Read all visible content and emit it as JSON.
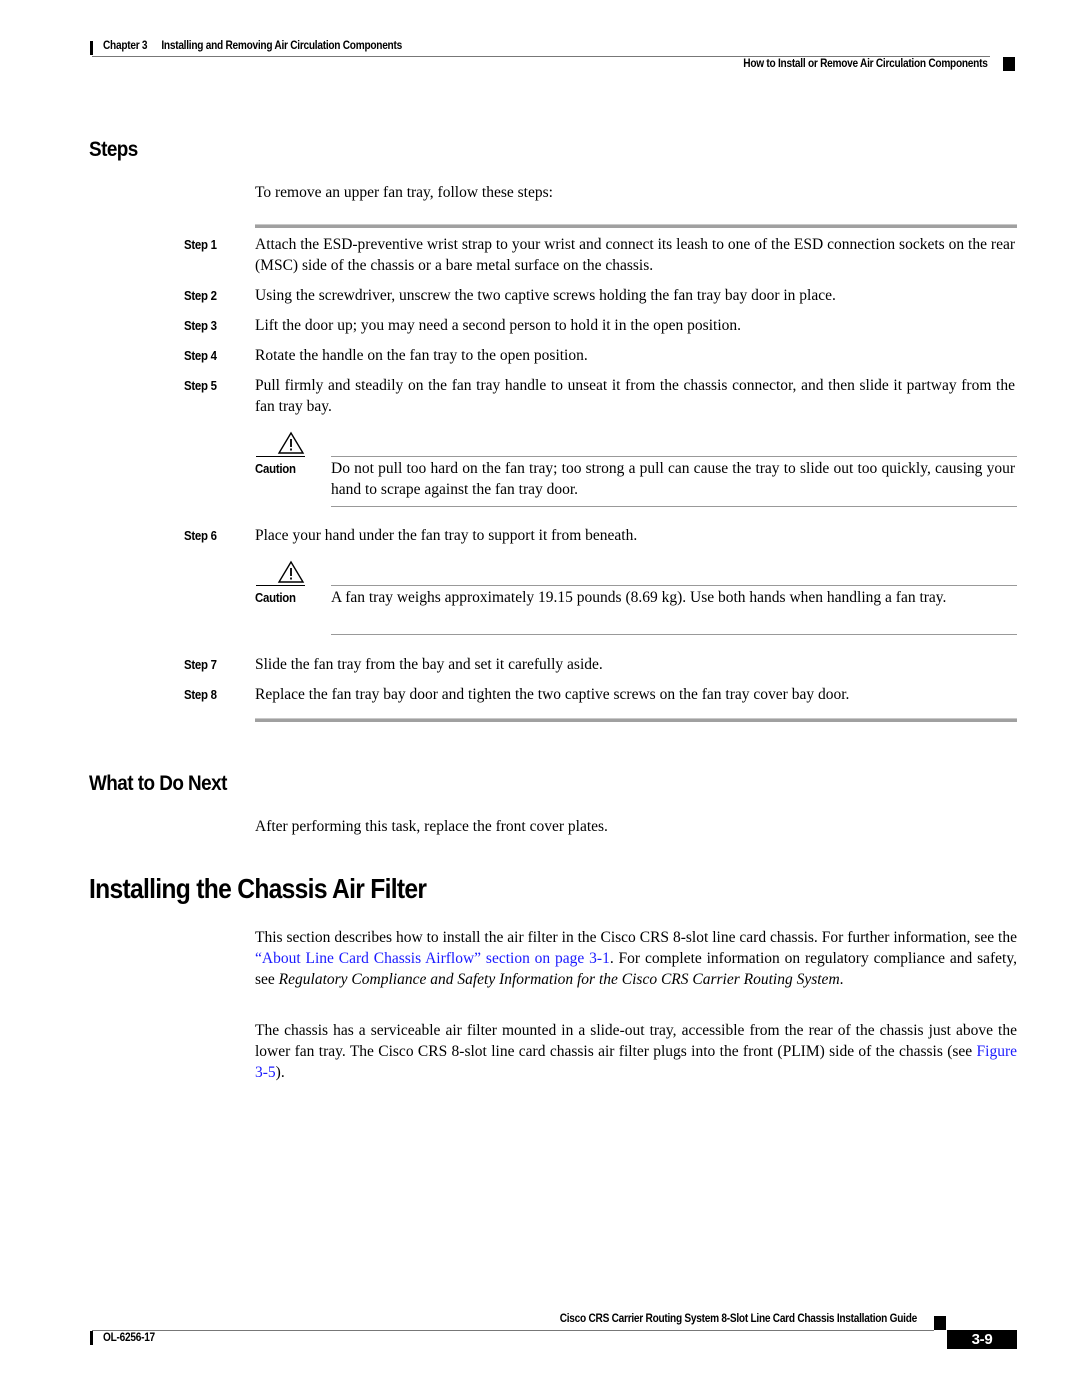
{
  "header": {
    "chapter": "Chapter 3",
    "chapter_title": "Installing and Removing Air Circulation Components",
    "section": "How to Install or Remove Air Circulation Components"
  },
  "steps_section": {
    "heading": "Steps",
    "intro": "To remove an upper fan tray, follow these steps:",
    "steps": [
      {
        "label": "Step 1",
        "text": "Attach the ESD-preventive wrist strap to your wrist and connect its leash to one of the ESD connection sockets on the rear (MSC) side of the chassis or a bare metal surface on the chassis."
      },
      {
        "label": "Step 2",
        "text": "Using the screwdriver, unscrew the two captive screws holding the fan tray bay door in place."
      },
      {
        "label": "Step 3",
        "text": "Lift the door up; you may need a second person to hold it in the open position."
      },
      {
        "label": "Step 4",
        "text": "Rotate the handle on the fan tray to the open position."
      },
      {
        "label": "Step 5",
        "text": "Pull firmly and steadily on the fan tray handle to unseat it from the chassis connector, and then slide it partway from the fan tray bay."
      },
      {
        "label": "Step 6",
        "text": "Place your hand under the fan tray to support it from beneath."
      },
      {
        "label": "Step 7",
        "text": "Slide the fan tray from the bay and set it carefully aside."
      },
      {
        "label": "Step 8",
        "text": "Replace the fan tray bay door and tighten the two captive screws on the fan tray cover bay door."
      }
    ],
    "cautions": [
      {
        "label": "Caution",
        "icon": "warning-triangle-icon",
        "text": "Do not pull too hard on the fan tray; too strong a pull can cause the tray to slide out too quickly, causing your hand to scrape against the fan tray door."
      },
      {
        "label": "Caution",
        "icon": "warning-triangle-icon",
        "text": "A fan tray weighs approximately 19.15 pounds (8.69 kg). Use both hands when handling a fan tray."
      }
    ]
  },
  "next_section": {
    "heading": "What to Do Next",
    "text": "After performing this task, replace the front cover plates."
  },
  "air_filter_section": {
    "heading": "Installing the Chassis Air Filter",
    "para1": {
      "text_a": "This section describes how to install the air filter in the Cisco CRS 8-slot line card chassis. For further information, see the ",
      "link": "“About Line Card Chassis Airflow” section on page 3-1",
      "text_b": ". For complete information on regulatory compliance and safety, see ",
      "italic": "Regulatory Compliance and Safety Information for the Cisco CRS Carrier Routing System",
      "text_c": "."
    },
    "para2": {
      "text_a": "The chassis has a serviceable air filter mounted in a slide-out tray, accessible from the rear of the chassis just above the lower fan tray. The Cisco CRS 8-slot line card chassis air filter plugs into the front (PLIM) side of the chassis (see ",
      "link": "Figure 3-5",
      "text_b": ")."
    }
  },
  "footer": {
    "guide_title": "Cisco CRS Carrier Routing System 8-Slot Line Card Chassis Installation Guide",
    "doc_number": "OL-6256-17",
    "page_number": "3-9"
  },
  "colors": {
    "link": "#1a1aff",
    "rule": "#a0a0a0"
  }
}
